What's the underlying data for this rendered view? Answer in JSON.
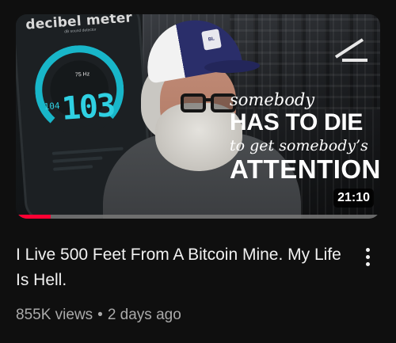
{
  "video": {
    "title": "I Live 500 Feet From A Bitcoin Mine. My Life Is Hell.",
    "views": "855K views",
    "separator": "•",
    "age": "2 days ago",
    "duration": "21:10",
    "watch_progress": 0.095
  },
  "thumbnail": {
    "meter_brand": "decibel meter",
    "meter_sub": "dB sound detector",
    "meter_reading": "103",
    "meter_small_reading": "104",
    "meter_unit": "75 Hz",
    "overlay_line1": "somebody",
    "overlay_line2": "HAS TO DIE",
    "overlay_line3": "to get somebody’s",
    "overlay_line4": "ATTENTION",
    "cap_logo": "BL"
  },
  "colors": {
    "background": "#0f0f0f",
    "progress": "#ff0033",
    "meter_accent": "#2fd0e2",
    "secondary_text": "#aaaaaa"
  },
  "icons": {
    "more": "more-vert-icon"
  }
}
